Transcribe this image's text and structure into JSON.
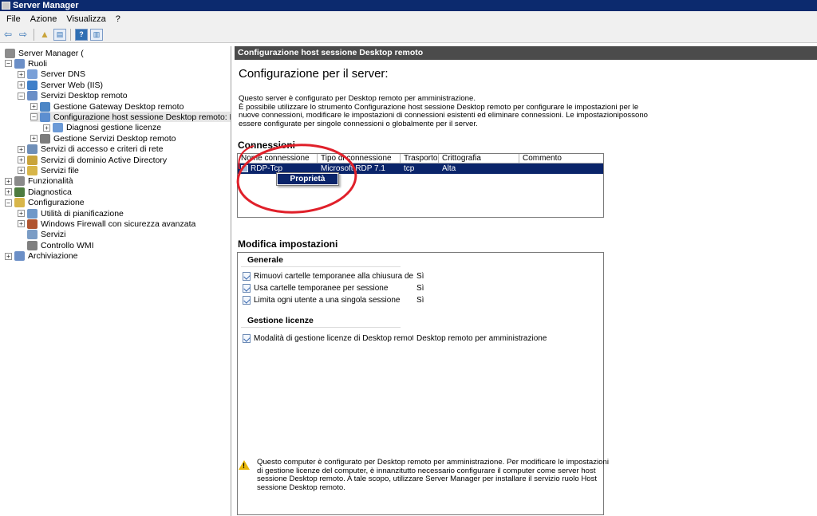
{
  "window": {
    "title": "Server Manager"
  },
  "menu": [
    "File",
    "Azione",
    "Visualizza",
    "?"
  ],
  "tree": [
    {
      "label": "Server Manager (",
      "level": 0,
      "exp": "",
      "icon": "#8c8c8c"
    },
    {
      "label": "Ruoli",
      "level": 0,
      "exp": "−",
      "icon": "#6b8fc7"
    },
    {
      "label": "Server DNS",
      "level": 1,
      "exp": "+",
      "icon": "#7aa0d8"
    },
    {
      "label": "Server Web (IIS)",
      "level": 1,
      "exp": "+",
      "icon": "#3f7fc9"
    },
    {
      "label": "Servizi Desktop remoto",
      "level": 1,
      "exp": "−",
      "icon": "#6b8fc7"
    },
    {
      "label": "Gestione Gateway Desktop remoto",
      "level": 2,
      "exp": "+",
      "icon": "#4c86c6"
    },
    {
      "label": "Configurazione host sessione Desktop remoto: Medigru",
      "level": 2,
      "exp": "−",
      "icon": "#5c8ed0",
      "selected": true
    },
    {
      "label": "Diagnosi gestione licenze",
      "level": 3,
      "exp": "+",
      "icon": "#6c9ad6"
    },
    {
      "label": "Gestione Servizi Desktop remoto",
      "level": 2,
      "exp": "+",
      "icon": "#7c7c7c"
    },
    {
      "label": "Servizi di accesso e criteri di rete",
      "level": 1,
      "exp": "+",
      "icon": "#6f8fb8"
    },
    {
      "label": "Servizi di dominio Active Directory",
      "level": 1,
      "exp": "+",
      "icon": "#c9a43c"
    },
    {
      "label": "Servizi file",
      "level": 1,
      "exp": "+",
      "icon": "#d8b64a"
    },
    {
      "label": "Funzionalità",
      "level": 0,
      "exp": "+",
      "icon": "#8a8a8a"
    },
    {
      "label": "Diagnostica",
      "level": 0,
      "exp": "+",
      "icon": "#4d7b3f"
    },
    {
      "label": "Configurazione",
      "level": 0,
      "exp": "−",
      "icon": "#d8b64a"
    },
    {
      "label": "Utilità di pianificazione",
      "level": 1,
      "exp": "+",
      "icon": "#6f98c9"
    },
    {
      "label": "Windows Firewall con sicurezza avanzata",
      "level": 1,
      "exp": "+",
      "icon": "#b0542f"
    },
    {
      "label": "Servizi",
      "level": 1,
      "exp": "",
      "icon": "#7a9cc5"
    },
    {
      "label": "Controllo WMI",
      "level": 1,
      "exp": "",
      "icon": "#7f7f7f"
    },
    {
      "label": "Archiviazione",
      "level": 0,
      "exp": "+",
      "icon": "#6b8fc7"
    }
  ],
  "pane": {
    "header": "Configurazione host sessione Desktop remoto",
    "title": "Configurazione per il server:",
    "intro": "Questo server è configurato per Desktop remoto per amministrazione.\nÈ possibile utilizzare lo strumento Configurazione host sessione Desktop remoto per configurare le impostazioni per le nuove connessioni, modificare le impostazioni di connessioni esistenti ed eliminare connessioni. Le impostazionipossono essere configurate per singole connessioni o globalmente per il server."
  },
  "connections": {
    "heading": "Connessioni",
    "columns": [
      "Nome connessione",
      "Tipo di connessione",
      "Trasporto",
      "Crittografia",
      "Commento"
    ],
    "rows": [
      {
        "name": "RDP-Tcp",
        "type": "Microsoft RDP 7.1",
        "transport": "tcp",
        "encryption": "Alta",
        "comment": ""
      }
    ],
    "context_menu": [
      "Proprietà"
    ]
  },
  "settings": {
    "heading": "Modifica impostazioni",
    "groups": [
      {
        "name": "Generale",
        "items": [
          {
            "name": "Rimuovi cartelle temporanee alla chiusura del ...",
            "value": "Sì"
          },
          {
            "name": "Usa cartelle temporanee per sessione",
            "value": "Sì"
          },
          {
            "name": "Limita ogni utente a una singola sessione",
            "value": "Sì"
          }
        ]
      },
      {
        "name": "Gestione licenze",
        "items": [
          {
            "name": "Modalità di gestione licenze di Desktop remoto",
            "value": "Desktop remoto per amministrazione"
          }
        ]
      }
    ]
  },
  "warning": "Questo computer è configurato per Desktop remoto per amministrazione. Per modificare le impostazioni di gestione licenze del computer, è innanzitutto necessario configurare il computer come server host sessione Desktop remoto. A tale scopo, utilizzare Server Manager per installare il servizio ruolo Host sessione Desktop remoto.",
  "colors": {
    "selection": "#0a246a",
    "header_bar": "#4b4b4b",
    "annotation": "#e0202a"
  }
}
